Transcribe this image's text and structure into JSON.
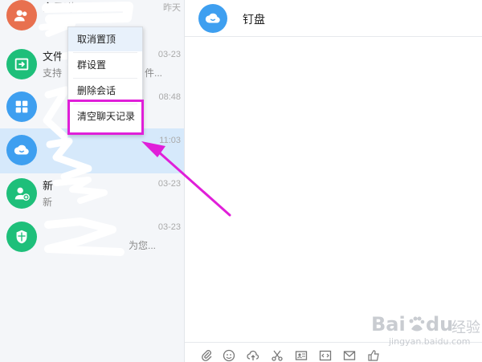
{
  "sidebar": {
    "conversations": [
      {
        "name": "全员群",
        "preview": "",
        "time": "昨天",
        "avatar_color": "#e8704f"
      },
      {
        "name": "文件",
        "preview": "支持",
        "time": "03-23",
        "avatar_color": "#1ebf7a"
      },
      {
        "name": "",
        "preview": "",
        "time": "08:48",
        "avatar_color": "#3e9ff0"
      },
      {
        "name": "",
        "preview": "",
        "time": "11:03",
        "avatar_color": "#3e9ff0"
      },
      {
        "name": "新",
        "preview": "新",
        "time": "03-23",
        "avatar_color": "#1ebf7a"
      },
      {
        "name": "",
        "preview": "为您...",
        "time": "03-23",
        "avatar_color": "#1ebf7a"
      }
    ],
    "preview_fragment_2": "件...",
    "active_index": 3
  },
  "context_menu": {
    "items": [
      "取消置顶",
      "群设置",
      "删除会话",
      "清空聊天记录"
    ],
    "hover_index": 0,
    "highlight_index": 3,
    "highlight_color": "#e01fd9"
  },
  "chat": {
    "title": "钉盘",
    "avatar_icon": "cloud-icon",
    "toolbar_icons": [
      "paperclip-icon",
      "emoji-icon",
      "cloud-upload-icon",
      "scissors-icon",
      "contact-card-icon",
      "code-icon",
      "mail-icon",
      "thumbs-up-icon"
    ]
  },
  "watermark": {
    "brand": "Bai",
    "brand_tail": "du",
    "suffix": "经验",
    "url": "jingyan.baidu.com"
  }
}
